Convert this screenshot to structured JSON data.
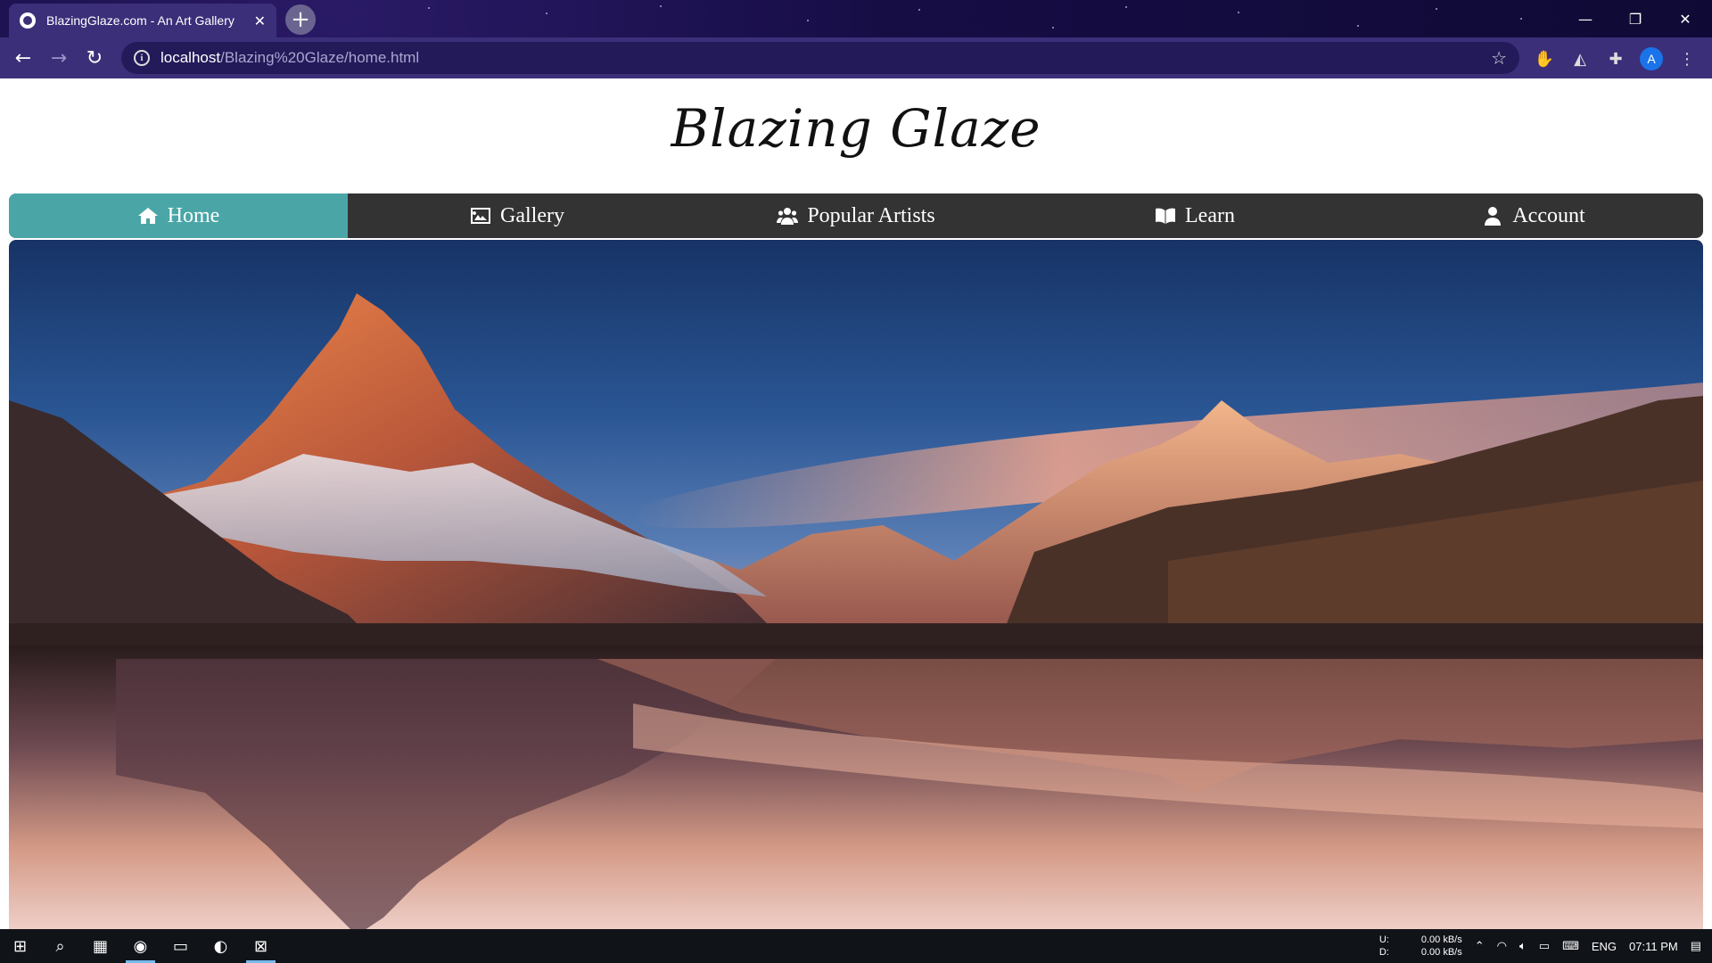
{
  "browser": {
    "tab_title": "BlazingGlaze.com - An Art Gallery",
    "url_host": "localhost",
    "url_path": "/Blazing%20Glaze/home.html",
    "new_tab_symbol": "+",
    "avatar_letter": "A"
  },
  "site": {
    "logo": "Blazing Glaze",
    "nav": [
      {
        "label": "Home",
        "icon": "home-icon"
      },
      {
        "label": "Gallery",
        "icon": "image-icon"
      },
      {
        "label": "Popular Artists",
        "icon": "users-icon"
      },
      {
        "label": "Learn",
        "icon": "book-icon"
      },
      {
        "label": "Account",
        "icon": "user-icon"
      }
    ],
    "active_nav": "Home"
  },
  "taskbar": {
    "net_up_label": "U:",
    "net_down_label": "D:",
    "net_up_value": "0.00 kB/s",
    "net_down_value": "0.00 kB/s",
    "language": "ENG",
    "time": "07:11 PM"
  },
  "colors": {
    "nav_bg": "#333333",
    "nav_active": "#4aa6a6",
    "browser_toolbar": "#3b2f7a"
  }
}
